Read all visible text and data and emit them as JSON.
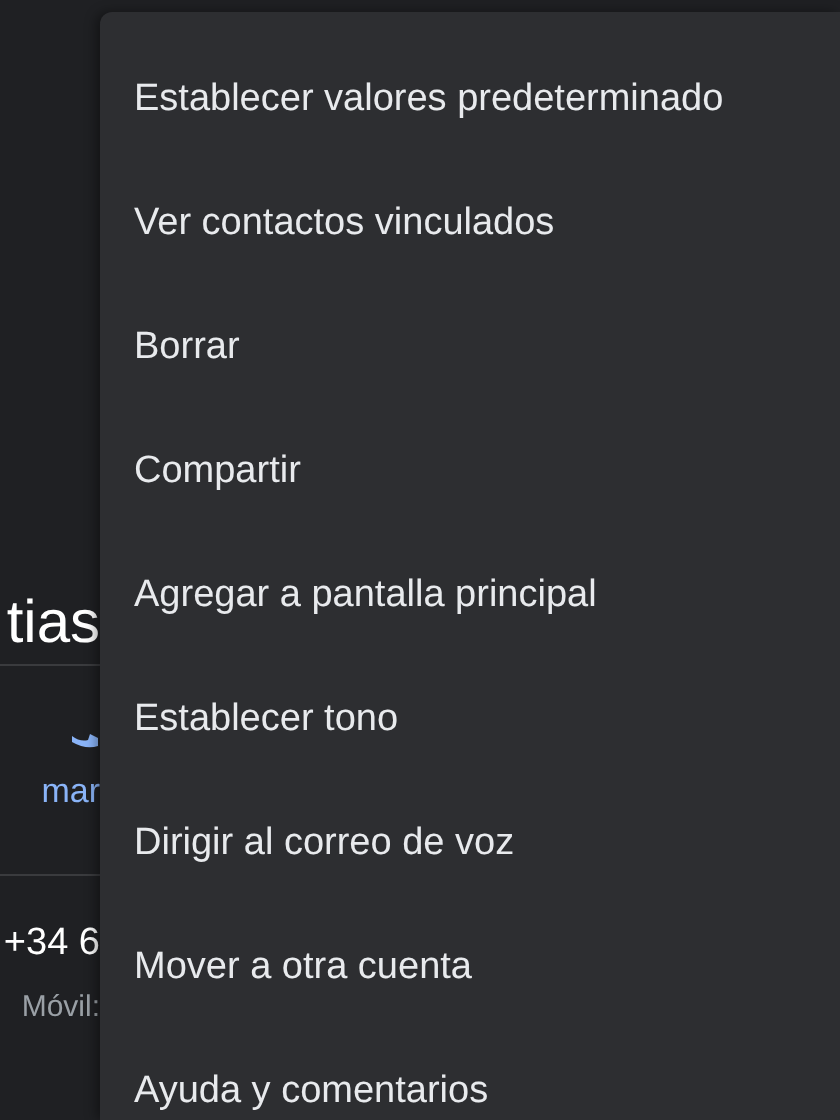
{
  "contact": {
    "name": "tias",
    "action_label": "mar",
    "phone_number": "+34 6",
    "phone_type": "Móvil:"
  },
  "menu": {
    "items": [
      {
        "label": "Establecer valores predeterminado"
      },
      {
        "label": "Ver contactos vinculados"
      },
      {
        "label": "Borrar"
      },
      {
        "label": "Compartir"
      },
      {
        "label": "Agregar a pantalla principal"
      },
      {
        "label": "Establecer tono"
      },
      {
        "label": "Dirigir al correo de voz"
      },
      {
        "label": "Mover a otra cuenta"
      },
      {
        "label": "Ayuda y comentarios"
      }
    ]
  }
}
